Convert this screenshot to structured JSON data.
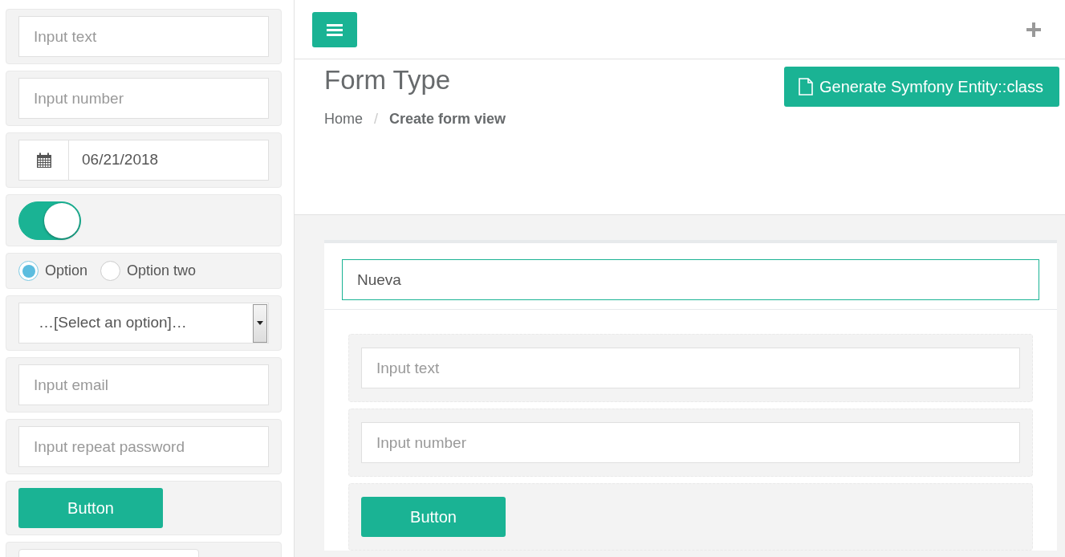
{
  "sidebar": {
    "items": [
      {
        "kind": "input",
        "placeholder": "Input text"
      },
      {
        "kind": "input",
        "placeholder": "Input number"
      },
      {
        "kind": "date",
        "value": "06/21/2018"
      },
      {
        "kind": "toggle",
        "on": true
      },
      {
        "kind": "radio",
        "options": [
          {
            "label": "Option",
            "selected": true
          },
          {
            "label": "Option two",
            "selected": false
          }
        ]
      },
      {
        "kind": "select",
        "value": "…[Select an option]…"
      },
      {
        "kind": "input",
        "placeholder": "Input email"
      },
      {
        "kind": "input",
        "placeholder": "Input repeat password"
      },
      {
        "kind": "button",
        "label": "Button"
      },
      {
        "kind": "blank"
      }
    ]
  },
  "header": {
    "title": "Form Type",
    "breadcrumb_separator": "/",
    "breadcrumb": [
      {
        "label": "Home",
        "selected": false
      },
      {
        "label": "Create form view",
        "selected": true
      }
    ],
    "action_button": "Generate Symfony Entity::class"
  },
  "form_panel": {
    "name_value": "Nueva",
    "items": [
      {
        "kind": "input",
        "placeholder": "Input text"
      },
      {
        "kind": "input",
        "placeholder": "Input number"
      },
      {
        "kind": "button",
        "label": "Button"
      }
    ]
  }
}
